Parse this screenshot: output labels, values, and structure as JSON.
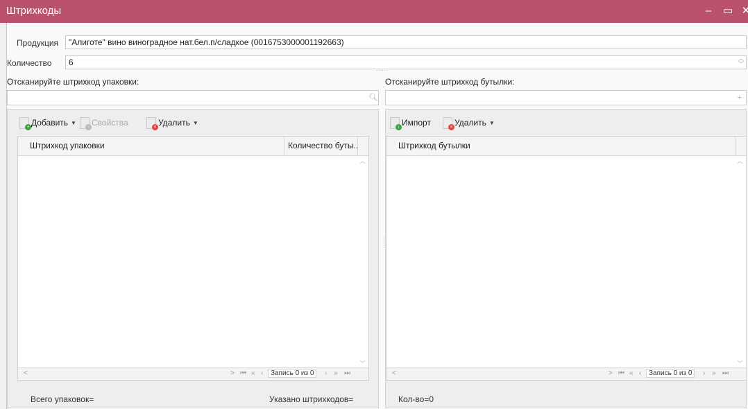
{
  "window": {
    "title": "Штрихкоды",
    "minimize_icon": "minimize-icon",
    "maximize_icon": "maximize-icon",
    "close_icon": "close-icon"
  },
  "form": {
    "product_label": "Продукция",
    "product_value": "\"Алиготе\" вино виноградное нат.бел.п/сладкое (0016753000001192663)",
    "quantity_label": "Количество",
    "quantity_value": "6"
  },
  "left": {
    "scan_label": "Отсканируйте штрихкод упаковки:",
    "scan_value": "",
    "toolbar": {
      "add_label": "Добавить",
      "properties_label": "Свойства",
      "delete_label": "Удалить"
    },
    "columns": [
      "Штрихкод упаковки",
      "Количество буты..."
    ],
    "rows": [],
    "pager_text": "Запись 0 из 0",
    "total_packages_label": "Всего упаковок=",
    "barcodes_specified_label": "Указано штрихкодов="
  },
  "right": {
    "scan_label": "Отсканируйте штрихкод бутылки:",
    "scan_value": "",
    "toolbar": {
      "import_label": "Импорт",
      "delete_label": "Удалить"
    },
    "columns": [
      "Штрихкод бутылки"
    ],
    "rows": [],
    "pager_text": "Запись 0 из 0",
    "count_label": "Кол-во=0"
  },
  "colors": {
    "titlebar": "#b9526a",
    "add_badge": "#3da33d",
    "delete_badge": "#e04848"
  }
}
